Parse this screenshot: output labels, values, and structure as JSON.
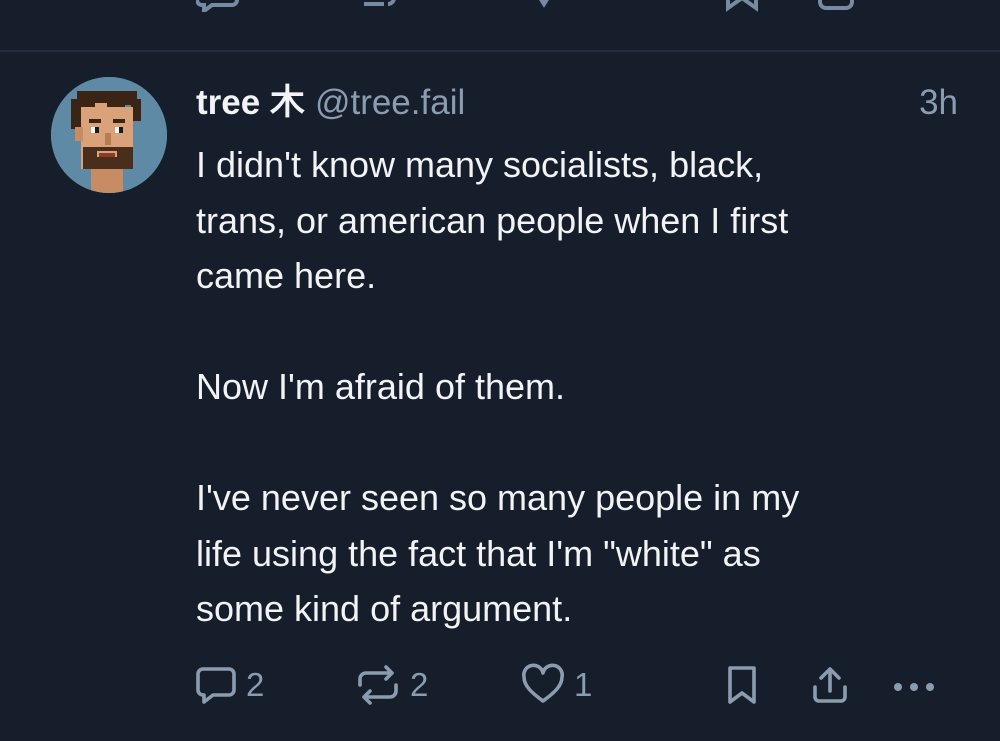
{
  "post": {
    "author": {
      "display_name": "tree 木",
      "handle": "@tree.fail"
    },
    "timestamp": "3h",
    "paragraphs": [
      "I didn't know many socialists, black,\ntrans, or american people when I first\ncame here.",
      "Now I'm afraid of them.",
      "I've never seen so many people in my\nlife using the fact that I'm \"white\" as\nsome kind of argument."
    ],
    "actions": {
      "reply_count": "2",
      "repost_count": "2",
      "like_count": "1"
    }
  },
  "icons": {
    "reply": "reply-icon",
    "repost": "repost-icon",
    "like": "heart-icon",
    "bookmark": "bookmark-icon",
    "share": "share-icon",
    "more": "more-icon"
  },
  "colors": {
    "background": "#161e2b",
    "text": "#f1f3f5",
    "muted": "#8b9bb0",
    "divider": "#222e3f",
    "avatar_bg": "#5f8aa6"
  }
}
